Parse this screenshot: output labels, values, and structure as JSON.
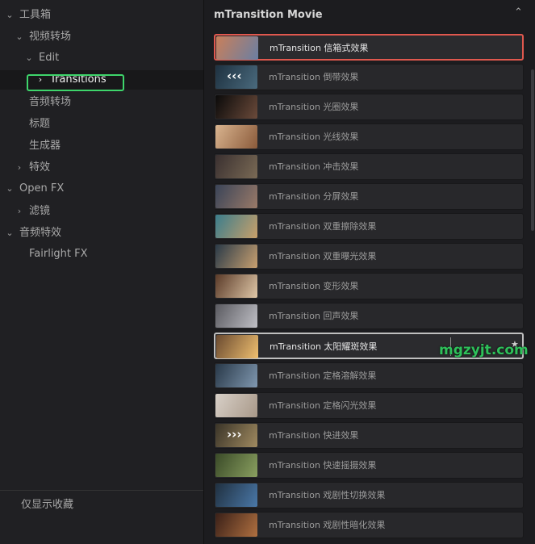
{
  "sidebar": {
    "items": [
      {
        "label": "工具箱",
        "chev": "⌄",
        "indent": 0
      },
      {
        "label": "视频转场",
        "chev": "⌄",
        "indent": 1
      },
      {
        "label": "Edit",
        "chev": "⌄",
        "indent": 2
      },
      {
        "label": "Transitions",
        "chev": "›",
        "indent": 3,
        "selected": true
      },
      {
        "label": "音频转场",
        "chev": "",
        "indent": 1
      },
      {
        "label": "标题",
        "chev": "",
        "indent": 1
      },
      {
        "label": "生成器",
        "chev": "",
        "indent": 1
      },
      {
        "label": "特效",
        "chev": "›",
        "indent": 1
      },
      {
        "label": "Open FX",
        "chev": "⌄",
        "indent": 0
      },
      {
        "label": "滤镜",
        "chev": "›",
        "indent": 1
      },
      {
        "label": "音频特效",
        "chev": "⌄",
        "indent": 0
      },
      {
        "label": "Fairlight FX",
        "chev": "",
        "indent": 1
      }
    ],
    "footer": "仅显示收藏"
  },
  "panel": {
    "title": "mTransition Movie",
    "collapse_icon": "chevron-up-icon"
  },
  "tiles": [
    {
      "label": "mTransition 信箱式效果",
      "colors": [
        "#c97f5a",
        "#6a7fa3"
      ],
      "state": "active"
    },
    {
      "label": "mTransition 倒带效果",
      "colors": [
        "#1e3140",
        "#4a6a7d"
      ],
      "arrows": "‹‹‹"
    },
    {
      "label": "mTransition 光圈效果",
      "colors": [
        "#0a0a0a",
        "#6b4a3a"
      ]
    },
    {
      "label": "mTransition 光线效果",
      "colors": [
        "#d9b48f",
        "#8a5a3a"
      ]
    },
    {
      "label": "mTransition 冲击效果",
      "colors": [
        "#3a3030",
        "#7a6a55"
      ]
    },
    {
      "label": "mTransition 分屏效果",
      "colors": [
        "#3a4458",
        "#9a7a68"
      ]
    },
    {
      "label": "mTransition 双重擦除效果",
      "colors": [
        "#3b7d8c",
        "#c9a06a"
      ]
    },
    {
      "label": "mTransition 双重曝光效果",
      "colors": [
        "#2a3a48",
        "#c8a070"
      ]
    },
    {
      "label": "mTransition 变形效果",
      "colors": [
        "#5a3a28",
        "#e0c8a8"
      ]
    },
    {
      "label": "mTransition 回声效果",
      "colors": [
        "#5a5a60",
        "#c0c0c6"
      ]
    },
    {
      "label": "mTransition 太阳耀斑效果",
      "colors": [
        "#6a4a30",
        "#f0c070"
      ],
      "state": "hover",
      "star": "★"
    },
    {
      "label": "mTransition 定格溶解效果",
      "colors": [
        "#283848",
        "#8098b0"
      ]
    },
    {
      "label": "mTransition 定格闪光效果",
      "colors": [
        "#d8d0c8",
        "#a89888"
      ]
    },
    {
      "label": "mTransition 快进效果",
      "colors": [
        "#3a3428",
        "#a08a60"
      ],
      "arrows": "›››"
    },
    {
      "label": "mTransition 快速摇摄效果",
      "colors": [
        "#3a4a28",
        "#8aa060"
      ]
    },
    {
      "label": "mTransition 戏剧性切换效果",
      "colors": [
        "#203040",
        "#4a78a8"
      ]
    },
    {
      "label": "mTransition 戏剧性暗化效果",
      "colors": [
        "#3a2018",
        "#b07040"
      ]
    }
  ],
  "watermark": "mgzyjt.com"
}
